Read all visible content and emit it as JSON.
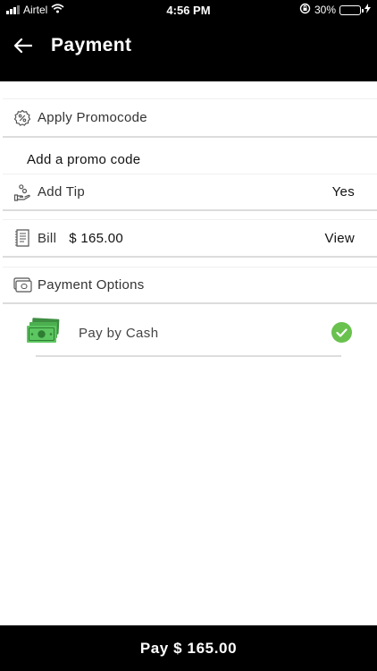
{
  "status_bar": {
    "carrier": "Airtel",
    "time": "4:56 PM",
    "battery_percent": "30%",
    "battery_level": 0.3,
    "icons": [
      "signal-icon",
      "wifi-icon",
      "rotation-lock-icon",
      "battery-icon",
      "charging-bolt-icon"
    ]
  },
  "header": {
    "title": "Payment",
    "back_icon": "back-arrow-icon"
  },
  "promocode": {
    "label": "Apply Promocode",
    "link": "Add a promo code",
    "icon": "discount-badge-icon"
  },
  "tip": {
    "label": "Add Tip",
    "value": "Yes",
    "icon": "tip-hand-icon"
  },
  "bill": {
    "label": "Bill",
    "amount": "$ 165.00",
    "action": "View",
    "icon": "receipt-icon"
  },
  "payment_options": {
    "label": "Payment Options",
    "icon": "wallet-icon",
    "items": [
      {
        "label": "Pay by Cash",
        "icon": "cash-icon",
        "selected": true,
        "check_icon": "check-circle-icon"
      }
    ]
  },
  "footer": {
    "pay_label": "Pay $ 165.00"
  },
  "colors": {
    "header_bg": "#000000",
    "check_green": "#69c14e",
    "cash_green": "#4caf50",
    "battery_yellow": "#f5c400"
  }
}
